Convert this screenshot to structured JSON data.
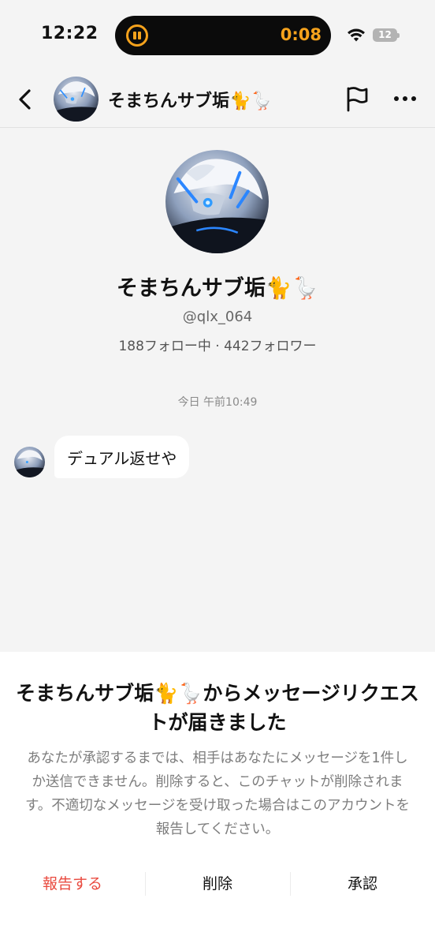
{
  "status_bar": {
    "time": "12:22",
    "recording_timer": "0:08",
    "battery_level": "12"
  },
  "header": {
    "title": "そまちんサブ垢🐈🪿"
  },
  "profile": {
    "name": "そまちんサブ垢🐈🪿",
    "handle": "@qlx_064",
    "stats": "188フォロー中 · 442フォロワー"
  },
  "chat": {
    "timestamp": "今日 午前10:49",
    "messages": [
      {
        "text": "デュアル返せや"
      }
    ]
  },
  "request_sheet": {
    "title": "そまちんサブ垢🐈🪿からメッセージリクエストが届きました",
    "body": "あなたが承認するまでは、相手はあなたにメッセージを1件しか送信できません。削除すると、このチャットが削除されます。不適切なメッセージを受け取った場合はこのアカウントを報告してください。",
    "actions": {
      "report": "報告する",
      "delete": "削除",
      "accept": "承認"
    }
  },
  "colors": {
    "accent_orange": "#f5a21c",
    "report_red": "#e94a3f",
    "background": "#f4f4f4"
  },
  "icons": [
    "back-icon",
    "flag-icon",
    "more-icon",
    "wifi-icon",
    "battery-icon",
    "pause-icon"
  ]
}
